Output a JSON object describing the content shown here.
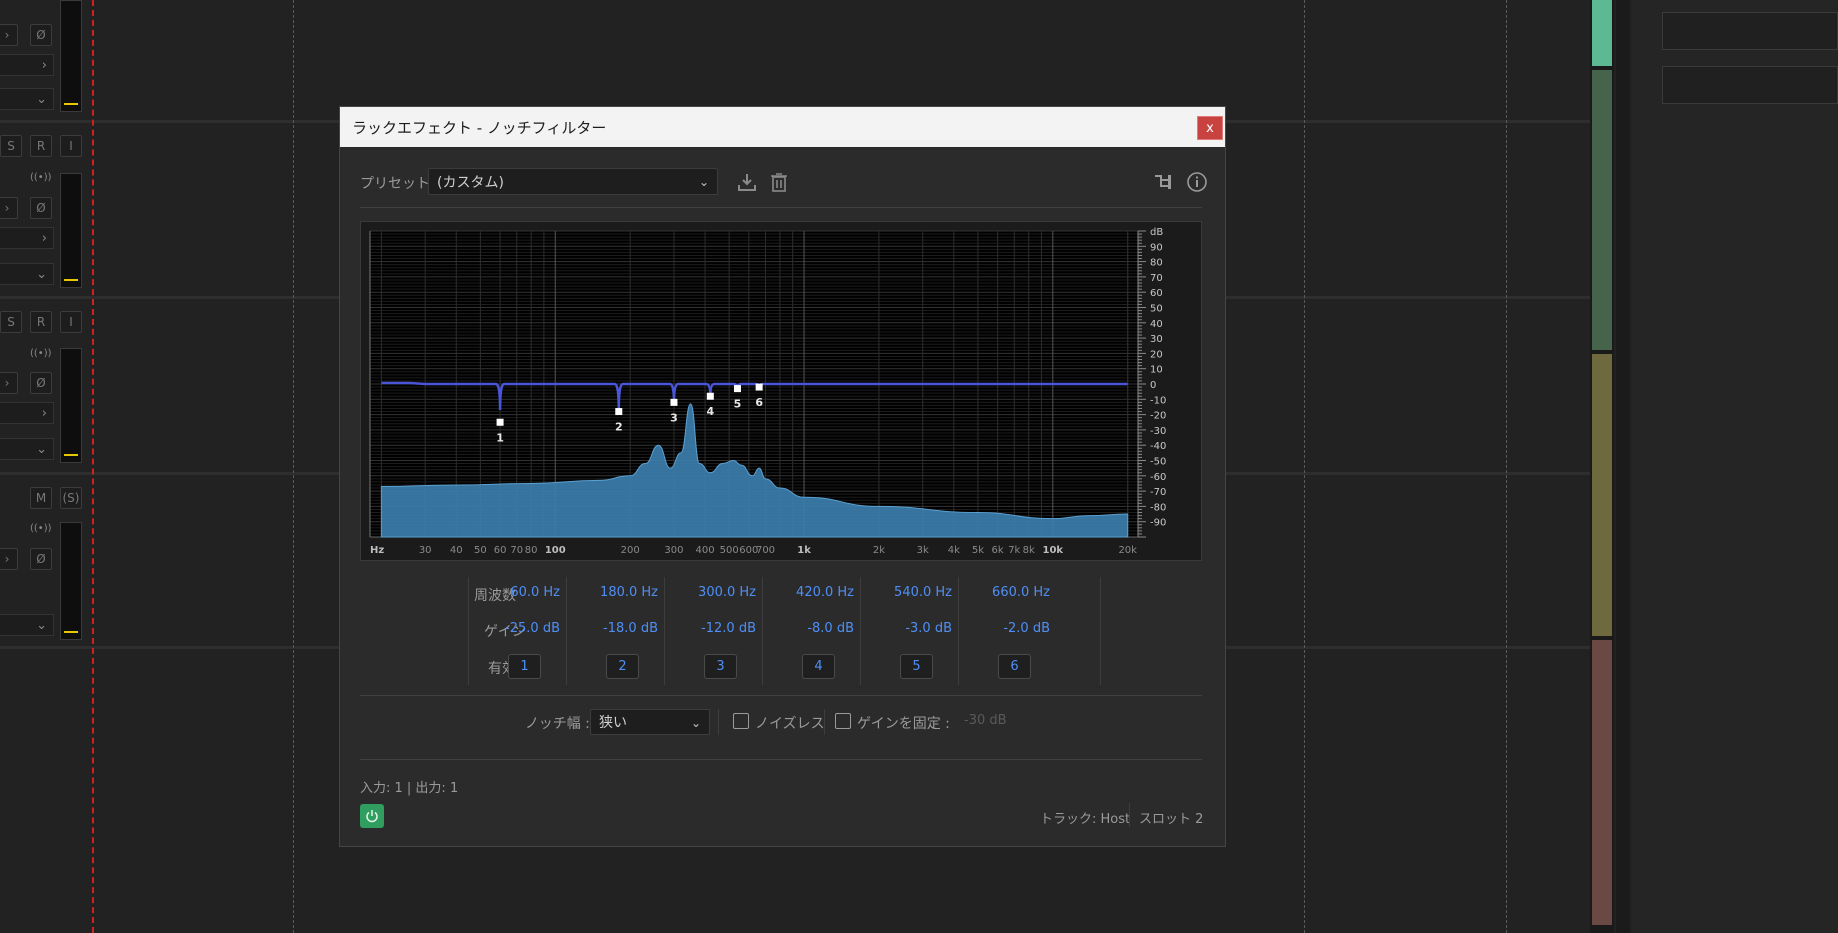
{
  "track_strip": {
    "buttons": [
      "S",
      "R",
      "I",
      "M",
      "(S)"
    ],
    "chevron": "›",
    "phase": "Ø",
    "input_icon": "((•))"
  },
  "dialog": {
    "title": "ラックエフェクト - ノッチフィルター",
    "close_label": "x",
    "preset_label": "プリセット :",
    "preset_value": "(カスタム)",
    "row_labels": {
      "freq": "周波数",
      "gain": "ゲイン",
      "enable": "有効"
    },
    "bands": [
      {
        "freq": "60.0 Hz",
        "gain": "-25.0 dB",
        "label": "1"
      },
      {
        "freq": "180.0 Hz",
        "gain": "-18.0 dB",
        "label": "2"
      },
      {
        "freq": "300.0 Hz",
        "gain": "-12.0 dB",
        "label": "3"
      },
      {
        "freq": "420.0 Hz",
        "gain": "-8.0 dB",
        "label": "4"
      },
      {
        "freq": "540.0 Hz",
        "gain": "-3.0 dB",
        "label": "5"
      },
      {
        "freq": "660.0 Hz",
        "gain": "-2.0 dB",
        "label": "6"
      }
    ],
    "notch_width_label": "ノッチ幅 :",
    "notch_width_value": "狭い",
    "noiseless_label": "ノイズレス",
    "fix_gain_label": "ゲインを固定 :",
    "fix_gain_value": "-30 dB",
    "io_text": "入力: 1 | 出力: 1",
    "track_text": "トラック: Host",
    "slot_text": "スロット 2",
    "colors": {
      "accent": "#4f8ff5",
      "curve": "#4a55d8",
      "spectrum": "#3d7fb0",
      "power": "#2f9e5f",
      "close": "#c8433f"
    }
  },
  "chart_data": {
    "type": "area",
    "x_ticks": [
      "Hz",
      "30",
      "40",
      "50",
      "60",
      "70",
      "80",
      "100",
      "200",
      "300",
      "400",
      "500",
      "600",
      "700",
      "1k",
      "2k",
      "3k",
      "4k",
      "5k",
      "6k",
      "7k",
      "8k",
      "10k",
      "20k"
    ],
    "y_ticks": [
      "dB",
      "90",
      "80",
      "70",
      "60",
      "50",
      "40",
      "30",
      "20",
      "10",
      "0",
      "-10",
      "-20",
      "-30",
      "-40",
      "-50",
      "-60",
      "-70",
      "-80",
      "-90"
    ],
    "ylim": [
      -100,
      100
    ],
    "x_scale": "log",
    "grid": true,
    "notch_points": [
      {
        "label": "1",
        "freq": 60,
        "gain": -25
      },
      {
        "label": "2",
        "freq": 180,
        "gain": -18
      },
      {
        "label": "3",
        "freq": 300,
        "gain": -12
      },
      {
        "label": "4",
        "freq": 420,
        "gain": -8
      },
      {
        "label": "5",
        "freq": 540,
        "gain": -3
      },
      {
        "label": "6",
        "freq": 660,
        "gain": -2
      }
    ],
    "spectrum": {
      "x": [
        20,
        40,
        80,
        150,
        200,
        230,
        260,
        290,
        320,
        350,
        380,
        420,
        470,
        520,
        560,
        620,
        660,
        700,
        800,
        1000,
        2000,
        5000,
        10000,
        14000,
        20000
      ],
      "y": [
        -67,
        -66,
        -65,
        -63,
        -60,
        -52,
        -40,
        -55,
        -45,
        -13,
        -52,
        -58,
        -52,
        -50,
        -53,
        -60,
        -55,
        -62,
        -68,
        -74,
        -80,
        -84,
        -88,
        -86,
        -85
      ]
    }
  }
}
